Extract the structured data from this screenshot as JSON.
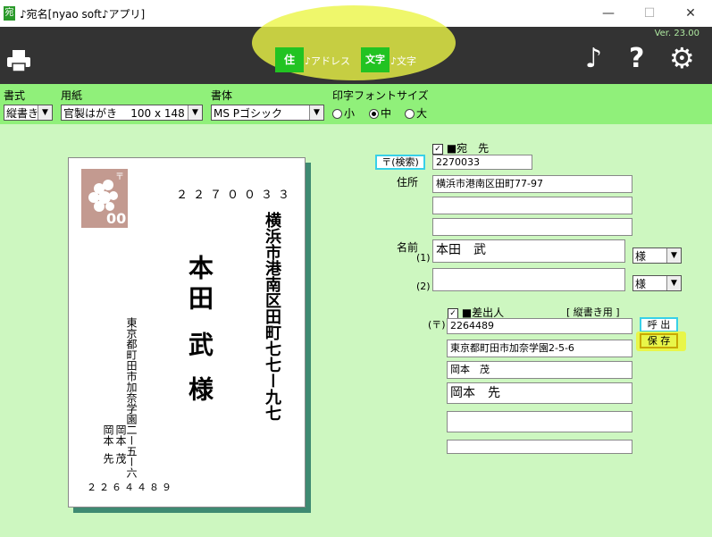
{
  "window": {
    "title": "♪宛名[nyao soft♪アプリ]",
    "app_icon_glyph": "宛",
    "minimize": "—",
    "maximize": "☐",
    "close": "✕"
  },
  "toolbar": {
    "version": "Ver. 23.00",
    "address_tool_box": "住",
    "address_tool_label": "♪アドレス",
    "text_tool_box": "文字",
    "text_tool_label": "♪文字",
    "print_icon": "print-icon",
    "music_glyph": "♪",
    "help_glyph": "?",
    "gear_glyph": "⚙"
  },
  "options": {
    "format_label": "書式",
    "format_value": "縦書き",
    "paper_label": "用紙",
    "paper_value": "官製はがき    100 x 148",
    "font_label": "書体",
    "font_value": "MS Pゴシック",
    "print_size_label": "印字フォントサイズ",
    "size_small": "小",
    "size_medium": "中",
    "size_large": "大",
    "size_selected": "中"
  },
  "card": {
    "stamp_value": "00",
    "zip": "２２７００３３",
    "address": "横浜市港南区田町七七ー九七",
    "name_line1": "本田",
    "name_line2": "武",
    "honorific": "様",
    "sender_address": "東京都町田市加奈学園二ー五ー六",
    "sender_name1_family": "岡本",
    "sender_name1_given": "茂",
    "sender_name2_family": "岡本",
    "sender_name2_given": "先",
    "sender_zip": "２２６４４８９"
  },
  "form": {
    "recipient_check": "✓",
    "recipient_header": "■宛　先",
    "zip_search_button": "〒(検索)",
    "recipient_zip": "2270033",
    "address_label": "住所",
    "address_line1": "横浜市港南区田町77-97",
    "address_line2": "",
    "address_line3": "",
    "name_label": "名前",
    "name1_index": "(1)",
    "name1_value": "本田　武",
    "name1_honorific": "様",
    "name2_index": "(2)",
    "name2_value": "",
    "name2_honorific": "様",
    "sender_check": "✓",
    "sender_header": "■差出人",
    "sender_mode": "[ 縦書き用 ]",
    "sender_zip_label": "(〒)",
    "sender_zip": "2264489",
    "call_button": "呼 出",
    "save_button": "保 存",
    "sender_address": "東京都町田市加奈学園2-5-6",
    "sender_name1": "岡本　茂",
    "sender_name2": "岡本　先",
    "sender_extra1": "",
    "sender_extra2": ""
  }
}
